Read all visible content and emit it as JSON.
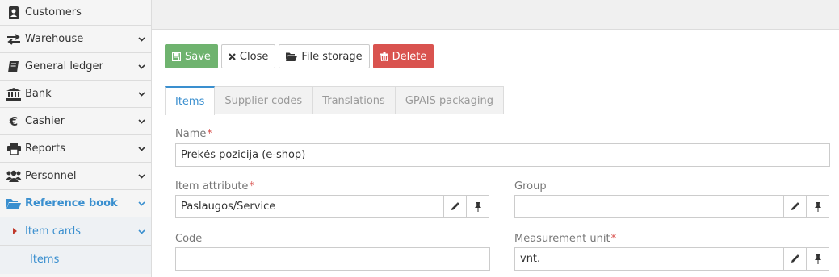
{
  "sidebar": {
    "items": [
      {
        "label": "Customers",
        "icon": "address-book-icon"
      },
      {
        "label": "Warehouse",
        "icon": "exchange-icon"
      },
      {
        "label": "General ledger",
        "icon": "book-icon"
      },
      {
        "label": "Bank",
        "icon": "bank-icon"
      },
      {
        "label": "Cashier",
        "icon": "euro-icon"
      },
      {
        "label": "Reports",
        "icon": "print-icon"
      },
      {
        "label": "Personnel",
        "icon": "users-icon"
      },
      {
        "label": "Reference book",
        "icon": "folder-open-icon"
      }
    ],
    "sub_item": "Item cards",
    "sub_sub_item": "Items"
  },
  "toolbar": {
    "save": "Save",
    "close": "Close",
    "file_storage": "File storage",
    "delete": "Delete"
  },
  "tabs": [
    {
      "label": "Items",
      "active": true
    },
    {
      "label": "Supplier codes",
      "active": false
    },
    {
      "label": "Translations",
      "active": false
    },
    {
      "label": "GPAIS packaging",
      "active": false
    }
  ],
  "form": {
    "name": {
      "label": "Name",
      "value": "Prekės pozicija (e-shop)"
    },
    "item_attribute": {
      "label": "Item attribute",
      "value": "Paslaugos/Service"
    },
    "group": {
      "label": "Group",
      "value": ""
    },
    "code": {
      "label": "Code",
      "value": ""
    },
    "measurement_unit": {
      "label": "Measurement unit",
      "value": "vnt."
    }
  },
  "colors": {
    "accent": "#3a8fcf",
    "save": "#6fb36f",
    "delete": "#d9534f",
    "required": "#d9534f"
  }
}
